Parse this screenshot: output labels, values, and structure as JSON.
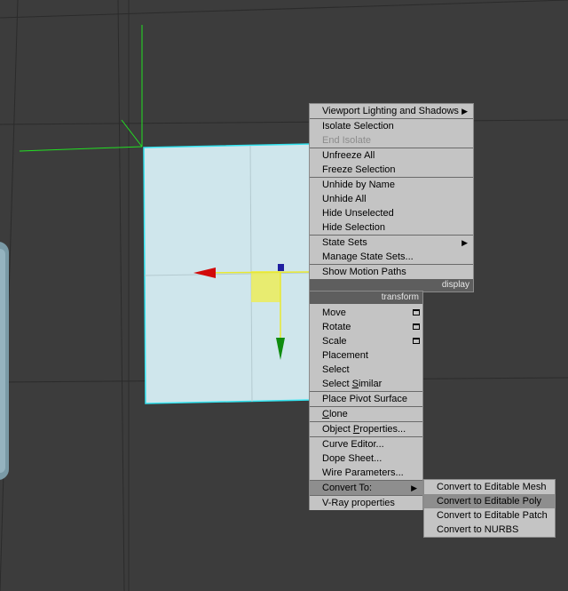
{
  "quad_display": {
    "header": "display",
    "items": [
      {
        "label": "Viewport Lighting and Shadows",
        "submenu": true
      },
      {
        "label": "Isolate Selection",
        "sep": true
      },
      {
        "label": "End Isolate",
        "disabled": true
      },
      {
        "label": "Unfreeze All",
        "sep": true
      },
      {
        "label": "Freeze Selection"
      },
      {
        "label": "Unhide by Name",
        "sep": true
      },
      {
        "label": "Unhide All"
      },
      {
        "label": "Hide Unselected"
      },
      {
        "label": "Hide Selection"
      },
      {
        "label": "State Sets",
        "sep": true,
        "submenu": true
      },
      {
        "label": "Manage State Sets..."
      },
      {
        "label": "Show Motion Paths",
        "sep": true
      }
    ]
  },
  "quad_transform": {
    "header": "transform",
    "items": [
      {
        "label": "Move",
        "settings": true
      },
      {
        "label": "Rotate",
        "settings": true
      },
      {
        "label": "Scale",
        "settings": true
      },
      {
        "label": "Placement"
      },
      {
        "label": "Select"
      },
      {
        "label": "Select Similar",
        "pre": "Select ",
        "ul": "S",
        "post": "imilar"
      },
      {
        "label": "Place Pivot Surface",
        "sep": true
      },
      {
        "label": "Clone",
        "sep": true,
        "pre": "",
        "ul": "C",
        "post": "lone"
      },
      {
        "label": "Object Properties...",
        "sep": true,
        "pre": "Object ",
        "ul": "P",
        "post": "roperties..."
      },
      {
        "label": "Curve Editor...",
        "sep": true
      },
      {
        "label": "Dope Sheet..."
      },
      {
        "label": "Wire Parameters..."
      },
      {
        "label": "Convert To:",
        "sep": true,
        "submenu": true,
        "highlighted": true
      },
      {
        "label": "V-Ray properties",
        "sep": true
      }
    ]
  },
  "convert_submenu": {
    "items": [
      {
        "label": "Convert to Editable Mesh"
      },
      {
        "label": "Convert to Editable Poly",
        "highlighted": true
      },
      {
        "label": "Convert to Editable Patch"
      },
      {
        "label": "Convert to NURBS"
      }
    ]
  },
  "colors": {
    "viewport_bg": "#3c3c3c",
    "grid": "#2c2c2c",
    "plane_fill": "#cfe6ec",
    "plane_edge": "#33e3ef",
    "gizmo_x": "#d20a0a",
    "gizmo_y": "#0f8c0f",
    "gizmo_plane": "#ecec5a",
    "menu_bg": "#c4c4c4",
    "menu_highlight": "#8e8e8e"
  }
}
